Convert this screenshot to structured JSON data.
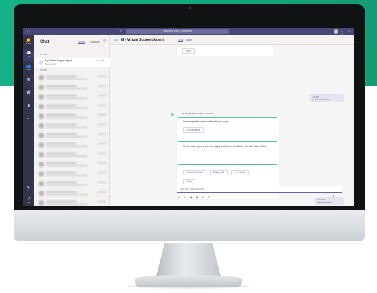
{
  "titlebar": {
    "search_placeholder": "Search or type a command",
    "nav_back": "‹",
    "nav_forward": "›",
    "compose_icon": "compose-icon",
    "window_controls": "— ◻ ✕"
  },
  "rail": {
    "items": [
      {
        "label": "Activity",
        "icon": "bell-icon",
        "glyph": "🔔"
      },
      {
        "label": "Chat",
        "icon": "chat-icon",
        "glyph": "💬",
        "active": true
      },
      {
        "label": "Teams",
        "icon": "teams-icon",
        "glyph": "👥"
      },
      {
        "label": "Calendar",
        "icon": "calendar-icon",
        "glyph": "▦"
      },
      {
        "label": "Calls",
        "icon": "phone-icon",
        "glyph": "☎"
      },
      {
        "label": "Files",
        "icon": "file-icon",
        "glyph": "▮"
      },
      {
        "label": "",
        "icon": "more-icon",
        "glyph": "···"
      },
      {
        "label": "Apps",
        "icon": "apps-icon",
        "glyph": "⊞"
      },
      {
        "label": "Help",
        "icon": "help-icon",
        "glyph": "?"
      }
    ]
  },
  "chatlist": {
    "title": "Chat",
    "tab_recent": "Recent",
    "tab_contacts": "Contacts",
    "section_pinned": "Pinned",
    "section_recent": "Recent",
    "active_chat": {
      "name": "My Virtual Support Agent",
      "preview": "Send a card",
      "time": "1:02 PM"
    }
  },
  "conversation": {
    "title": "My Virtual Support Agent",
    "tab_chat": "Chat",
    "tab_about": "About",
    "help_button": "help",
    "user_msg_1": {
      "meta": "1:01 PM",
      "text": "my phone is broken"
    },
    "bot_meta": "My Virtual Support Agent  1:01 PM",
    "bot_card_text": "Here a topic that should match with your query.",
    "phone_issues_button": "Phone Issues",
    "bot_card2_text": "Tell me what is your problem by typing Cracked screen, Battery life, Lost data or Other.",
    "options": [
      "Cracked Screen",
      "Battery Life",
      "Lost Data",
      "Other"
    ],
    "user_msg_2": {
      "meta": "1:01 PM",
      "text": "cracked screen"
    },
    "compose_placeholder": "Type your questions here",
    "compose_tools": "A ☺ ▣ ▤ ⊳ ⇪ ···",
    "send_glyph": "➤"
  }
}
